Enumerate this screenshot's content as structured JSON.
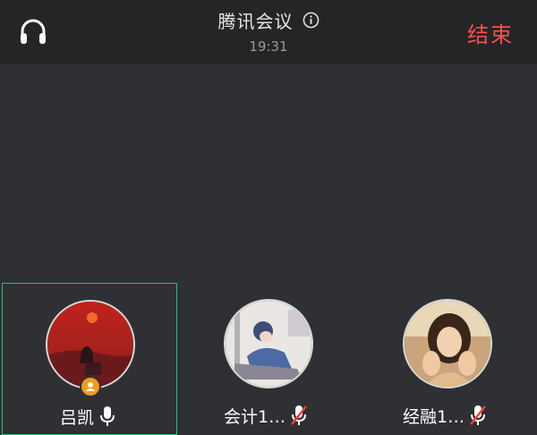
{
  "header": {
    "title": "腾讯会议",
    "time": "19:31",
    "end_label": "结束"
  },
  "icons": {
    "left": "headset-icon",
    "title_info": "info-icon"
  },
  "colors": {
    "end": "#ff4d4d",
    "active_border": "#1fbf6e",
    "host_badge": "#f39a1d",
    "muted_slash": "#ff3b30"
  },
  "participants": [
    {
      "name": "吕凯",
      "mic": "on",
      "host": true,
      "active": true
    },
    {
      "name": "会计1…",
      "mic": "muted",
      "host": false,
      "active": false
    },
    {
      "name": "经融1…",
      "mic": "muted",
      "host": false,
      "active": false
    }
  ]
}
